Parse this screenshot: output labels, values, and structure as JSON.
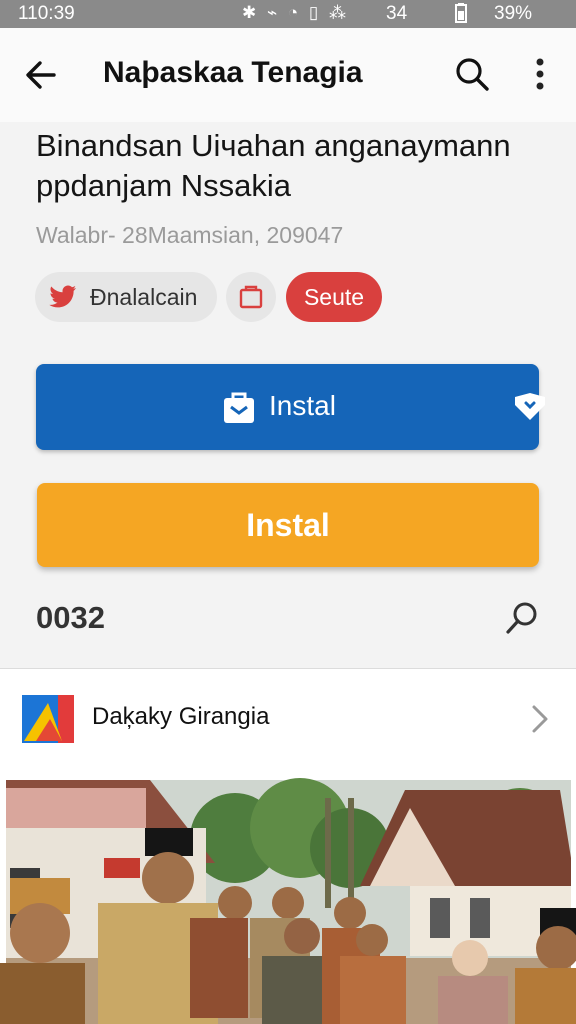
{
  "status_bar": {
    "time": "110:39",
    "icons": "✱ ⌁ ◔ ▯ ⁂",
    "signal_text": "34",
    "battery": "39%"
  },
  "app_bar": {
    "title": "Naþaskaa Tenagia",
    "back_icon": "arrow-left-icon",
    "search_icon": "search-icon",
    "more_icon": "more-vertical-icon"
  },
  "article": {
    "headline": "Binandsan Uiчahan anganaymann ppdanjam Nssakia",
    "meta": "Walabr- 28Maamsian, 209047",
    "chips": [
      {
        "label": "Đnalalcain",
        "icon": "twitter-bird-icon"
      },
      {
        "label": "",
        "icon": "clipboard-icon"
      },
      {
        "label": "Seute",
        "color": "#d9403e"
      }
    ],
    "primary_button": {
      "label": "Instal",
      "color": "#1565b8"
    },
    "secondary_button": {
      "label": "Instal",
      "color": "#f5a623"
    },
    "count": "0032"
  },
  "source": {
    "name": "Daķaky Girangia"
  }
}
